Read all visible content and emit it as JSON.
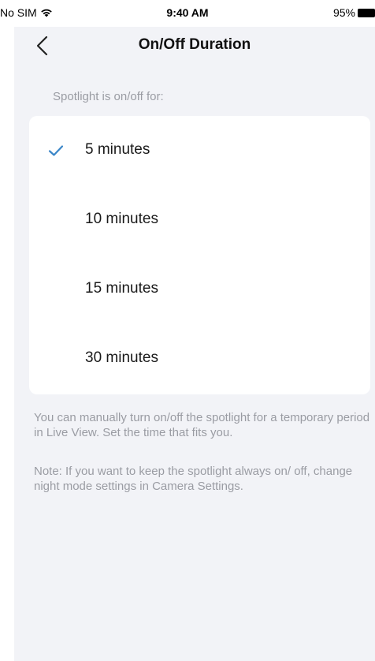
{
  "status_bar": {
    "carrier": "No SIM",
    "time": "9:40 AM",
    "battery": "95%"
  },
  "header": {
    "title": "On/Off Duration"
  },
  "section": {
    "header": "Spotlight is on/off for:"
  },
  "options": [
    {
      "label": "5 minutes",
      "selected": true
    },
    {
      "label": "10 minutes",
      "selected": false
    },
    {
      "label": "15 minutes",
      "selected": false
    },
    {
      "label": "30 minutes",
      "selected": false
    }
  ],
  "info": {
    "description": "You can manually turn on/off the spotlight for a temporary period in Live View. Set the time that fits you.",
    "note": "Note: If you want to keep the spotlight always on/ off, change night mode settings in Camera Settings."
  },
  "colors": {
    "accent": "#3a86c8",
    "background": "#f2f3f7",
    "muted_text": "#9a9ca3"
  }
}
